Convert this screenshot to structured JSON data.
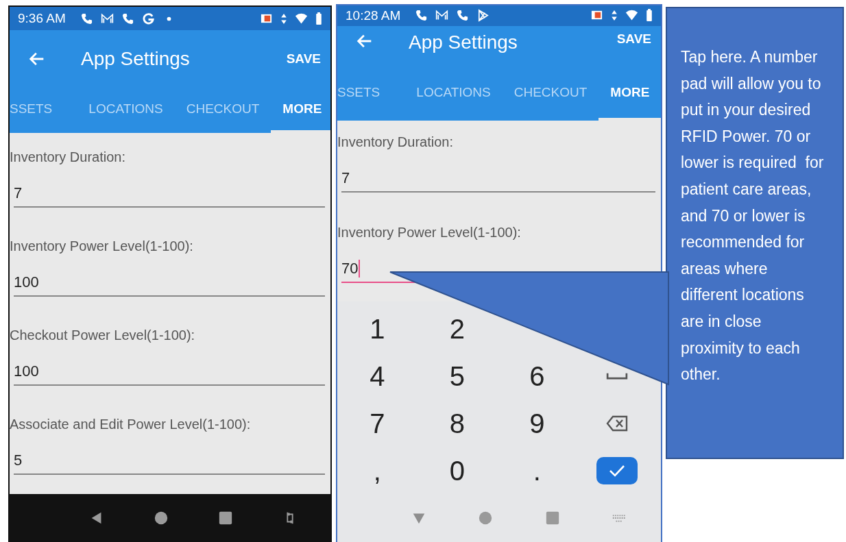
{
  "phones": [
    {
      "status_bar": {
        "time": "9:36 AM",
        "notification_icons": [
          {
            "kind": "phone"
          },
          {
            "kind": "mail"
          },
          {
            "kind": "phone"
          },
          {
            "kind": "g"
          },
          {
            "kind": "dot"
          }
        ]
      },
      "app_bar": {
        "title": "App Settings",
        "action": "SAVE"
      },
      "tabs": [
        {
          "label": "SSETS",
          "selected": false
        },
        {
          "label": "LOCATIONS",
          "selected": false
        },
        {
          "label": "CHECKOUT",
          "selected": false
        },
        {
          "label": "MORE",
          "selected": true
        }
      ],
      "fields": [
        {
          "label": "Inventory Duration:",
          "value": "7",
          "focused": false
        },
        {
          "label": "Inventory Power Level(1-100):",
          "value": "100",
          "focused": false
        },
        {
          "label": "Checkout Power Level(1-100):",
          "value": "100",
          "focused": false
        },
        {
          "label": "Associate and Edit Power Level(1-100):",
          "value": "5",
          "focused": false
        }
      ]
    },
    {
      "status_bar": {
        "time": "10:28 AM",
        "notification_icons": [
          {
            "kind": "phone"
          },
          {
            "kind": "mail"
          },
          {
            "kind": "phone"
          },
          {
            "kind": "play"
          }
        ]
      },
      "app_bar": {
        "title": "App Settings",
        "action": "SAVE"
      },
      "tabs": [
        {
          "label": "SSETS",
          "selected": false
        },
        {
          "label": "LOCATIONS",
          "selected": false
        },
        {
          "label": "CHECKOUT",
          "selected": false
        },
        {
          "label": "MORE",
          "selected": true
        }
      ],
      "fields": [
        {
          "label": "Inventory Duration:",
          "value": "7",
          "focused": false
        },
        {
          "label": "Inventory Power Level(1-100):",
          "value": "70",
          "focused": true
        }
      ],
      "keyboard": {
        "rows": [
          [
            {
              "kind": "char",
              "label": "1"
            },
            {
              "kind": "char",
              "label": "2"
            }
          ],
          [
            {
              "kind": "char",
              "label": "4"
            },
            {
              "kind": "char",
              "label": "5"
            },
            {
              "kind": "char",
              "label": "6"
            },
            {
              "kind": "space"
            }
          ],
          [
            {
              "kind": "char",
              "label": "7"
            },
            {
              "kind": "char",
              "label": "8"
            },
            {
              "kind": "char",
              "label": "9"
            },
            {
              "kind": "backspace"
            }
          ],
          [
            {
              "kind": "char",
              "label": ","
            },
            {
              "kind": "char",
              "label": "0"
            },
            {
              "kind": "char",
              "label": "."
            },
            {
              "kind": "done"
            }
          ]
        ]
      }
    }
  ],
  "callout": {
    "text": "Tap here. A number pad will allow you to put in your desired RFID Power. 70 or lower is required  for patient care areas, and 70 or lower is recommended for areas where different locations are in close proximity to each other."
  }
}
